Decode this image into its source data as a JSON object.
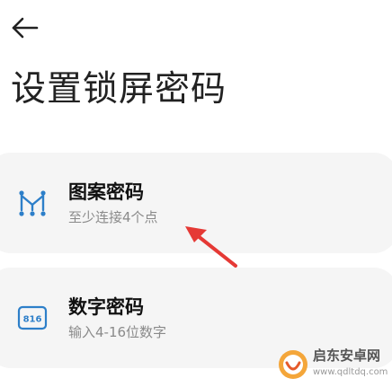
{
  "header": {
    "back_icon": "arrow-left-icon",
    "title": "设置锁屏密码"
  },
  "options": [
    {
      "icon": "pattern-icon",
      "title": "图案密码",
      "subtitle": "至少连接4个点"
    },
    {
      "icon": "pin-816-icon",
      "icon_text": "816",
      "title": "数字密码",
      "subtitle": "输入4-16位数字"
    }
  ],
  "annotation": {
    "arrow_color": "#e53935"
  },
  "watermark": {
    "name": "启东安卓网",
    "url": "www.qdltdq.com"
  },
  "colors": {
    "accent": "#2d7fc9",
    "card_bg": "#f5f5f5"
  }
}
